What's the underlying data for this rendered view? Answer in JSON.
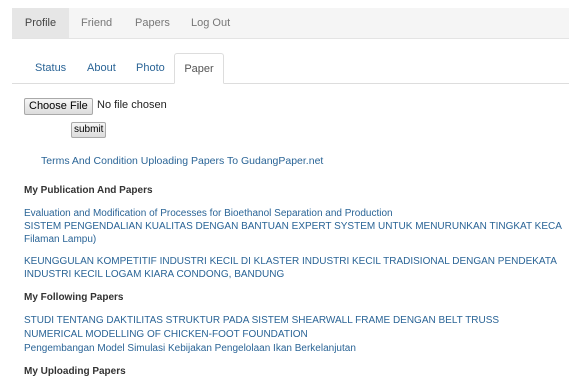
{
  "top_nav": {
    "items": [
      "Profile",
      "Friend",
      "Papers",
      "Log Out"
    ]
  },
  "tabs": [
    "Status",
    "About",
    "Photo",
    "Paper"
  ],
  "upload": {
    "choose_file_label": "Choose File",
    "file_status": "No file chosen",
    "submit_label": "submit"
  },
  "terms_link": "Terms And Condition Uploading Papers To GudangPaper.net",
  "publications": {
    "title": "My Publication And Papers",
    "items": [
      "Evaluation and Modification of Processes for Bioethanol Separation and Production",
      "SISTEM PENGENDALIAN KUALITAS DENGAN BANTUAN EXPERT SYSTEM UNTUK MENURUNKAN TINGKAT KECA",
      "Filaman Lampu)",
      "KEUNGGULAN KOMPETITIF INDUSTRI KECIL DI KLASTER INDUSTRI KECIL TRADISIONAL DENGAN PENDEKATA",
      "INDUSTRI KECIL LOGAM KIARA CONDONG, BANDUNG"
    ]
  },
  "following": {
    "title": "My Following Papers",
    "items": [
      "STUDI TENTANG DAKTILITAS STRUKTUR PADA SISTEM SHEARWALL FRAME DENGAN BELT TRUSS",
      "NUMERICAL MODELLING OF CHICKEN-FOOT FOUNDATION",
      "Pengembangan Model Simulasi Kebijakan Pengelolaan Ikan Berkelanjutan"
    ]
  },
  "uploading": {
    "title": "My Uploading Papers"
  }
}
